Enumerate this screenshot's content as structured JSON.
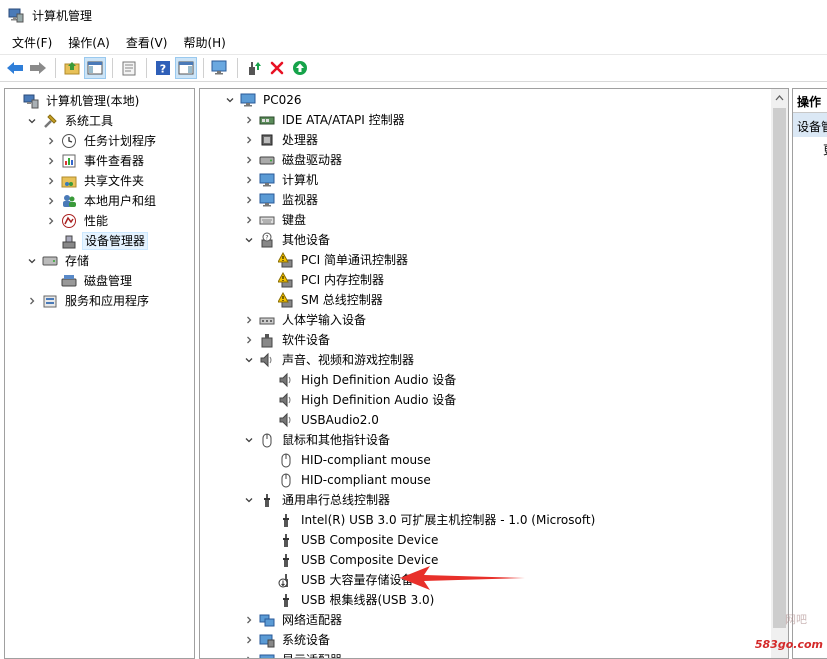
{
  "window": {
    "title": "计算机管理"
  },
  "menu": [
    "文件(F)",
    "操作(A)",
    "查看(V)",
    "帮助(H)"
  ],
  "toolbar": {
    "buttons": [
      "back-icon",
      "forward-icon",
      "up-folder-icon",
      "show-tree-icon",
      "properties-icon",
      "help-icon",
      "action-pane-icon",
      "monitor-icon",
      "update-driver-icon",
      "uninstall-icon",
      "enable-icon"
    ]
  },
  "left_tree": [
    {
      "label": "计算机管理(本地)",
      "icon": "computer-management-icon",
      "level": 0,
      "chev": "none"
    },
    {
      "label": "系统工具",
      "icon": "tools-icon",
      "level": 1,
      "chev": "down"
    },
    {
      "label": "任务计划程序",
      "icon": "clock-icon",
      "level": 2,
      "chev": "right"
    },
    {
      "label": "事件查看器",
      "icon": "event-viewer-icon",
      "level": 2,
      "chev": "right"
    },
    {
      "label": "共享文件夹",
      "icon": "shared-folder-icon",
      "level": 2,
      "chev": "right"
    },
    {
      "label": "本地用户和组",
      "icon": "users-icon",
      "level": 2,
      "chev": "right"
    },
    {
      "label": "性能",
      "icon": "performance-icon",
      "level": 2,
      "chev": "right"
    },
    {
      "label": "设备管理器",
      "icon": "device-manager-icon",
      "level": 2,
      "chev": "none",
      "selected": true
    },
    {
      "label": "存储",
      "icon": "storage-icon",
      "level": 1,
      "chev": "down"
    },
    {
      "label": "磁盘管理",
      "icon": "disk-management-icon",
      "level": 2,
      "chev": "none"
    },
    {
      "label": "服务和应用程序",
      "icon": "services-icon",
      "level": 1,
      "chev": "right"
    }
  ],
  "device_tree": [
    {
      "label": "PC026",
      "icon": "computer-icon",
      "level": 0,
      "chev": "down"
    },
    {
      "label": "IDE ATA/ATAPI 控制器",
      "icon": "ide-controller-icon",
      "level": 1,
      "chev": "right"
    },
    {
      "label": "处理器",
      "icon": "processor-icon",
      "level": 1,
      "chev": "right"
    },
    {
      "label": "磁盘驱动器",
      "icon": "disk-drive-icon",
      "level": 1,
      "chev": "right"
    },
    {
      "label": "计算机",
      "icon": "computer-icon",
      "level": 1,
      "chev": "right"
    },
    {
      "label": "监视器",
      "icon": "monitor-icon",
      "level": 1,
      "chev": "right"
    },
    {
      "label": "键盘",
      "icon": "keyboard-icon",
      "level": 1,
      "chev": "right"
    },
    {
      "label": "其他设备",
      "icon": "unknown-device-icon",
      "level": 1,
      "chev": "down"
    },
    {
      "label": "PCI 简单通讯控制器",
      "icon": "warning-device-icon",
      "level": 2,
      "chev": "none"
    },
    {
      "label": "PCI 内存控制器",
      "icon": "warning-device-icon",
      "level": 2,
      "chev": "none"
    },
    {
      "label": "SM 总线控制器",
      "icon": "warning-device-icon",
      "level": 2,
      "chev": "none"
    },
    {
      "label": "人体学输入设备",
      "icon": "hid-icon",
      "level": 1,
      "chev": "right"
    },
    {
      "label": "软件设备",
      "icon": "software-device-icon",
      "level": 1,
      "chev": "right"
    },
    {
      "label": "声音、视频和游戏控制器",
      "icon": "speaker-icon",
      "level": 1,
      "chev": "down"
    },
    {
      "label": "High Definition Audio 设备",
      "icon": "speaker-icon",
      "level": 2,
      "chev": "none"
    },
    {
      "label": "High Definition Audio 设备",
      "icon": "speaker-icon",
      "level": 2,
      "chev": "none"
    },
    {
      "label": "USBAudio2.0",
      "icon": "speaker-icon",
      "level": 2,
      "chev": "none"
    },
    {
      "label": "鼠标和其他指针设备",
      "icon": "mouse-icon",
      "level": 1,
      "chev": "down"
    },
    {
      "label": "HID-compliant mouse",
      "icon": "mouse-icon",
      "level": 2,
      "chev": "none"
    },
    {
      "label": "HID-compliant mouse",
      "icon": "mouse-icon",
      "level": 2,
      "chev": "none"
    },
    {
      "label": "通用串行总线控制器",
      "icon": "usb-icon",
      "level": 1,
      "chev": "down"
    },
    {
      "label": "Intel(R) USB 3.0 可扩展主机控制器 - 1.0 (Microsoft)",
      "icon": "usb-icon",
      "level": 2,
      "chev": "none"
    },
    {
      "label": "USB Composite Device",
      "icon": "usb-icon",
      "level": 2,
      "chev": "none"
    },
    {
      "label": "USB Composite Device",
      "icon": "usb-icon",
      "level": 2,
      "chev": "none"
    },
    {
      "label": "USB 大容量存储设备",
      "icon": "usb-disabled-icon",
      "level": 2,
      "chev": "none",
      "highlight": true
    },
    {
      "label": "USB 根集线器(USB 3.0)",
      "icon": "usb-icon",
      "level": 2,
      "chev": "none"
    },
    {
      "label": "网络适配器",
      "icon": "network-adapter-icon",
      "level": 1,
      "chev": "right"
    },
    {
      "label": "系统设备",
      "icon": "system-device-icon",
      "level": 1,
      "chev": "right"
    },
    {
      "label": "显示适配器",
      "icon": "display-adapter-icon",
      "level": 1,
      "chev": "right"
    }
  ],
  "actions": {
    "header": "操作",
    "item": "设备管理器",
    "sub": "更"
  },
  "watermark": {
    "site": "583go.com",
    "faded": "网吧"
  },
  "colors": {
    "selection": "#e5f3ff",
    "arrow": "#e8302a",
    "action_bg": "#dbe8f5",
    "warning": "#f5c400",
    "disable_red": "#e81123",
    "enable_green": "#16a34a"
  }
}
